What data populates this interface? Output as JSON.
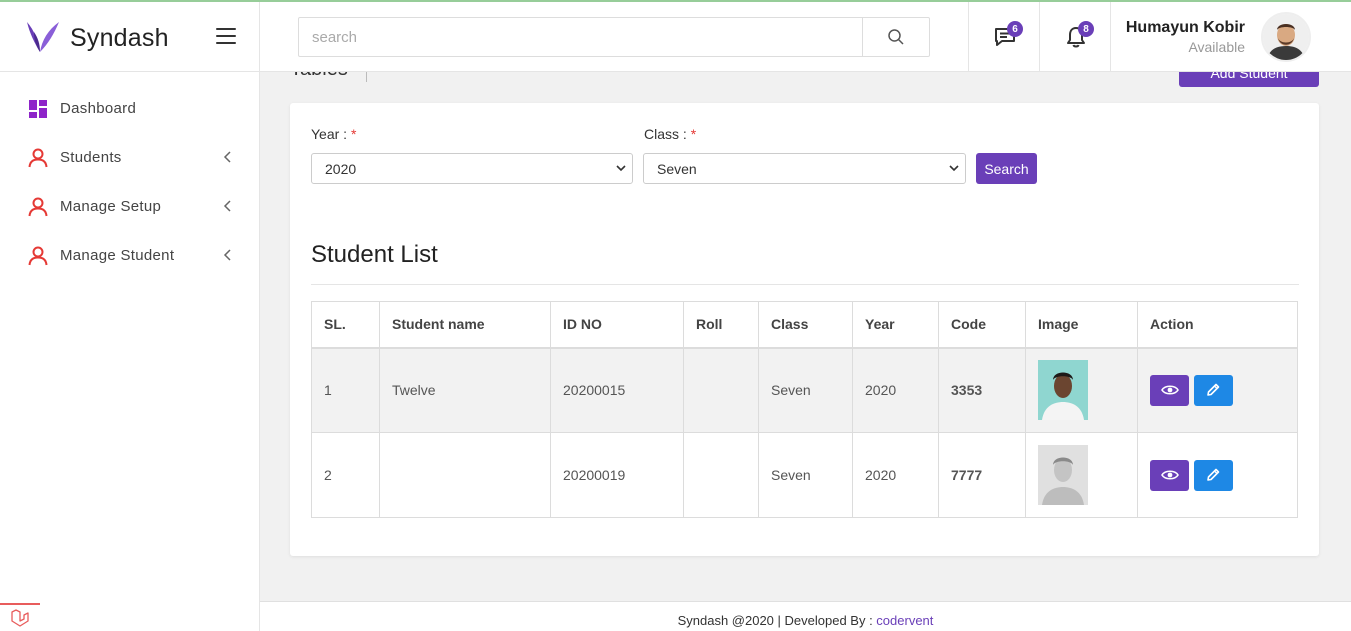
{
  "brand": {
    "name": "Syndash",
    "accent": "#6a3fb8"
  },
  "header": {
    "search_placeholder": "search",
    "messages_count": "6",
    "notifications_count": "8",
    "user_name": "Humayun Kobir",
    "user_status": "Available"
  },
  "sidebar": {
    "items": [
      {
        "label": "Dashboard",
        "icon": "dashboard-grid-icon"
      },
      {
        "label": "Students",
        "icon": "user-icon"
      },
      {
        "label": "Manage Setup",
        "icon": "user-icon"
      },
      {
        "label": "Manage Student",
        "icon": "user-icon"
      }
    ]
  },
  "page": {
    "breadcrumb_title": "Tables",
    "add_button_label": "Add Student"
  },
  "filters": {
    "year_label": "Year : ",
    "year_value": "2020",
    "class_label": "Class : ",
    "class_value": "Seven",
    "required_mark": "*",
    "search_label": "Search"
  },
  "student_list": {
    "title": "Student List",
    "columns": [
      "SL.",
      "Student name",
      "ID NO",
      "Roll",
      "Class",
      "Year",
      "Code",
      "Image",
      "Action"
    ],
    "rows": [
      {
        "sl": "1",
        "name": "Twelve",
        "id_no": "20200015",
        "roll": "",
        "class": "Seven",
        "year": "2020",
        "code": "3353"
      },
      {
        "sl": "2",
        "name": "",
        "id_no": "20200019",
        "roll": "",
        "class": "Seven",
        "year": "2020",
        "code": "7777"
      }
    ]
  },
  "footer": {
    "text": "Syndash @2020 | Developed By : ",
    "link": "codervent"
  }
}
